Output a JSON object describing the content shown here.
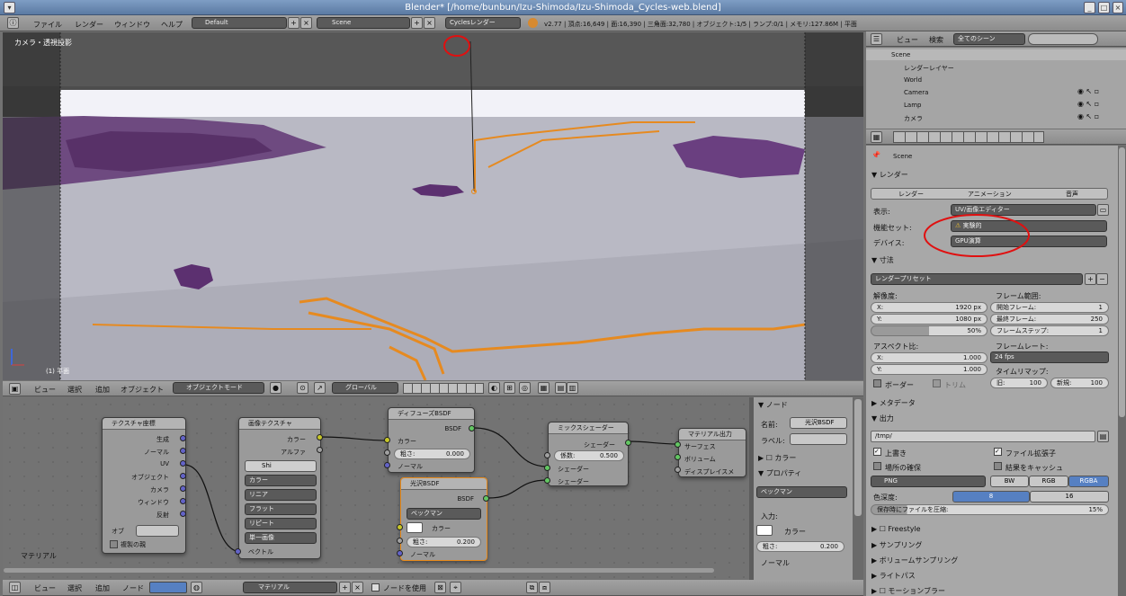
{
  "window": {
    "title": "Blender* [/home/bunbun/Izu-Shimoda/Izu-Shimoda_Cycles-web.blend]"
  },
  "topbar": {
    "menus": [
      "ファイル",
      "レンダー",
      "ウィンドウ",
      "ヘルプ"
    ],
    "layout": "Default",
    "scene": "Scene",
    "engine": "Cyclesレンダー",
    "stats": "v2.77 | 頂点:16,649 | 面:16,390 | 三角面:32,780 | オブジェクト:1/5 | ランプ:0/1 | メモリ:127.86M | 平面"
  },
  "viewport": {
    "label": "カメラ・透視投影",
    "object_label": "(1) 平面"
  },
  "view3d_header": {
    "menus": [
      "ビュー",
      "選択",
      "追加",
      "オブジェクト"
    ],
    "mode": "オブジェクトモード",
    "pivot": "グローバル"
  },
  "outliner": {
    "view_label": "ビュー",
    "search_label": "検索",
    "filter": "全てのシーン",
    "items": [
      "Scene",
      "レンダーレイヤー",
      "World",
      "Camera",
      "Lamp",
      "カメラ"
    ]
  },
  "properties": {
    "scene_path": "Scene",
    "render_section": "レンダー",
    "tabs": [
      "レンダー",
      "アニメーション",
      "音声"
    ],
    "display_label": "表示:",
    "display_value": "UV/画像エディター",
    "feature_label": "機能セット:",
    "feature_value": "実験的",
    "device_label": "デバイス:",
    "device_value": "GPU演算",
    "dimensions_section": "寸法",
    "preset": "レンダープリセット",
    "resolution_label": "解像度:",
    "res_x": "1920 px",
    "res_y": "1080 px",
    "res_pct": "50%",
    "frame_range_label": "フレーム範囲:",
    "frame_start": "開始フレーム:",
    "frame_start_v": "1",
    "frame_end": "最終フレーム:",
    "frame_end_v": "250",
    "frame_step": "フレームステップ:",
    "frame_step_v": "1",
    "aspect_label": "アスペクト比:",
    "asp_x": "1.000",
    "asp_y": "1.000",
    "framerate_label": "フレームレート:",
    "framerate": "24 fps",
    "timemap_label": "タイムリマップ:",
    "old": "旧:",
    "old_v": "100",
    "new": "新規:",
    "new_v": "100",
    "border": "ボーダー",
    "crop": "トリム",
    "metadata_section": "メタデータ",
    "output_section": "出力",
    "output_path": "/tmp/",
    "overwrite": "上書き",
    "file_ext": "ファイル拡張子",
    "placeholders": "場所の確保",
    "cache": "結果をキャッシュ",
    "format": "PNG",
    "bw": "BW",
    "rgb": "RGB",
    "rgba": "RGBA",
    "depth_label": "色深度:",
    "depth_8": "8",
    "depth_16": "16",
    "compression": "保存時にファイルを圧縮:",
    "compression_v": "15%",
    "sections": [
      "Freestyle",
      "サンプリング",
      "ボリュームサンプリング",
      "ライトパス",
      "モーションブラー"
    ]
  },
  "node_editor": {
    "label": "マテリアル",
    "texcoord": {
      "title": "テクスチャ座標",
      "outputs": [
        "生成",
        "ノーマル",
        "UV",
        "オブジェクト",
        "カメラ",
        "ウィンドウ",
        "反射"
      ],
      "object_label": "オブ",
      "from_dupli": "複製の親"
    },
    "imgtex": {
      "title": "画像テクスチャ",
      "outputs": [
        "カラー",
        "アルファ"
      ],
      "img_name": "Shi",
      "color": "カラー",
      "interp": "リニア",
      "proj": "フラット",
      "ext": "リピート",
      "source": "単一画像",
      "vector": "ベクトル"
    },
    "diffuse": {
      "title": "ディフューズBSDF",
      "out": "BSDF",
      "color": "カラー",
      "rough_label": "粗さ:",
      "rough": "0.000",
      "normal": "ノーマル"
    },
    "glossy": {
      "title": "光沢BSDF",
      "out": "BSDF",
      "dist": "ベックマン",
      "color": "カラー",
      "rough_label": "粗さ:",
      "rough": "0.200",
      "normal": "ノーマル"
    },
    "mix": {
      "title": "ミックスシェーダー",
      "out": "シェーダー",
      "fac_label": "係数:",
      "fac": "0.500",
      "in1": "シェーダー",
      "in2": "シェーダー"
    },
    "output": {
      "title": "マテリアル出力",
      "surface": "サーフェス",
      "volume": "ボリューム",
      "displacement": "ディスプレイスメ"
    }
  },
  "node_sidebar": {
    "node_section": "ノード",
    "name_label": "名前:",
    "name_value": "光沢BSDF",
    "label_label": "ラベル:",
    "color_section": "カラー",
    "props_section": "プロパティ",
    "dist": "ベックマン",
    "input_label": "入力:",
    "color": "カラー",
    "rough_label": "粗さ:",
    "rough": "0.200",
    "normal": "ノーマル"
  },
  "node_header": {
    "menus": [
      "ビュー",
      "選択",
      "追加",
      "ノード"
    ],
    "material": "マテリアル",
    "use_nodes": "ノードを使用"
  },
  "colors": {
    "accent_blue": "#5680c2",
    "annotation_red": "#e01010",
    "node_orange": "#e88a1a"
  }
}
